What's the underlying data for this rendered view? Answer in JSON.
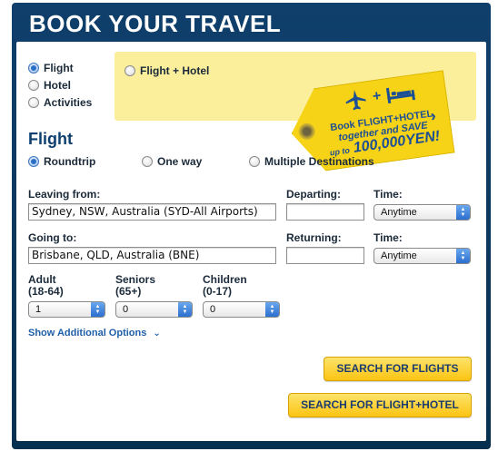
{
  "header": {
    "title": "BOOK YOUR TRAVEL"
  },
  "product_types": [
    {
      "label": "Flight",
      "selected": true
    },
    {
      "label": "Hotel",
      "selected": false
    },
    {
      "label": "Activities",
      "selected": false
    }
  ],
  "promo": {
    "option_label": "Flight + Hotel",
    "tag_line1": "Book FLIGHT+HOTEL",
    "tag_line2": "together and SAVE",
    "tag_line3_prefix": "up to",
    "tag_line3_amount": "100,000YEN!"
  },
  "flight": {
    "heading": "Flight",
    "trip_types": [
      {
        "label": "Roundtrip",
        "selected": true
      },
      {
        "label": "One way",
        "selected": false
      },
      {
        "label": "Multiple Destinations",
        "selected": false
      }
    ],
    "leaving_label": "Leaving from:",
    "leaving_value": "Sydney, NSW, Australia (SYD-All Airports)",
    "departing_label": "Departing:",
    "departing_value": "",
    "time_label_1": "Time:",
    "time_value_1": "Anytime",
    "going_label": "Going to:",
    "going_value": "Brisbane, QLD, Australia (BNE)",
    "returning_label": "Returning:",
    "returning_value": "",
    "time_label_2": "Time:",
    "time_value_2": "Anytime"
  },
  "passengers": {
    "adult_label": "Adult",
    "adult_range": "(18-64)",
    "adult_value": "1",
    "seniors_label": "Seniors",
    "seniors_range": "(65+)",
    "seniors_value": "0",
    "children_label": "Children",
    "children_range": "(0-17)",
    "children_value": "0"
  },
  "options_link": "Show Additional Options",
  "buttons": {
    "search_flights": "SEARCH FOR FLIGHTS",
    "search_flight_hotel": "SEARCH FOR FLIGHT+HOTEL"
  },
  "colors": {
    "panel": "#0f3f6b",
    "promo_bg": "#fbef9c",
    "tag": "#f7d317",
    "button": "#fbc413",
    "link": "#1e5fa8"
  }
}
